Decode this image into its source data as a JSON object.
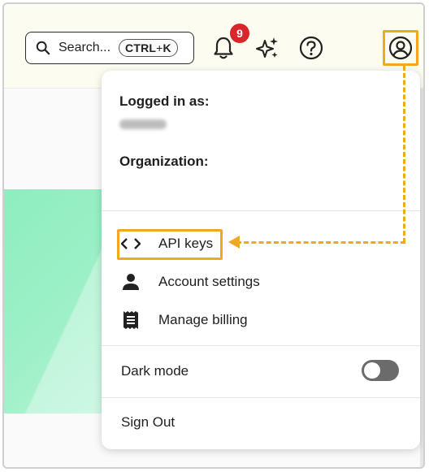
{
  "header": {
    "search_placeholder": "Search...",
    "shortcut_main": "CTRL",
    "shortcut_plus": "+",
    "shortcut_key": "K",
    "notification_count": "9",
    "icons": [
      "search-icon",
      "bell-icon",
      "sparkle-icon",
      "help-icon",
      "user-icon"
    ]
  },
  "menu": {
    "logged_in_label": "Logged in as:",
    "organization_label": "Organization:",
    "items": [
      {
        "label": "API keys",
        "icon": "code-icon"
      },
      {
        "label": "Account settings",
        "icon": "person-icon"
      },
      {
        "label": "Manage billing",
        "icon": "receipt-icon"
      }
    ],
    "dark_mode_label": "Dark mode",
    "dark_mode_on": false,
    "sign_out_label": "Sign Out"
  },
  "colors": {
    "highlight": "#f0a81c",
    "badge": "#d8262a",
    "hero_green": "#9ef0c8",
    "toggle_off": "#6b6b6b"
  }
}
